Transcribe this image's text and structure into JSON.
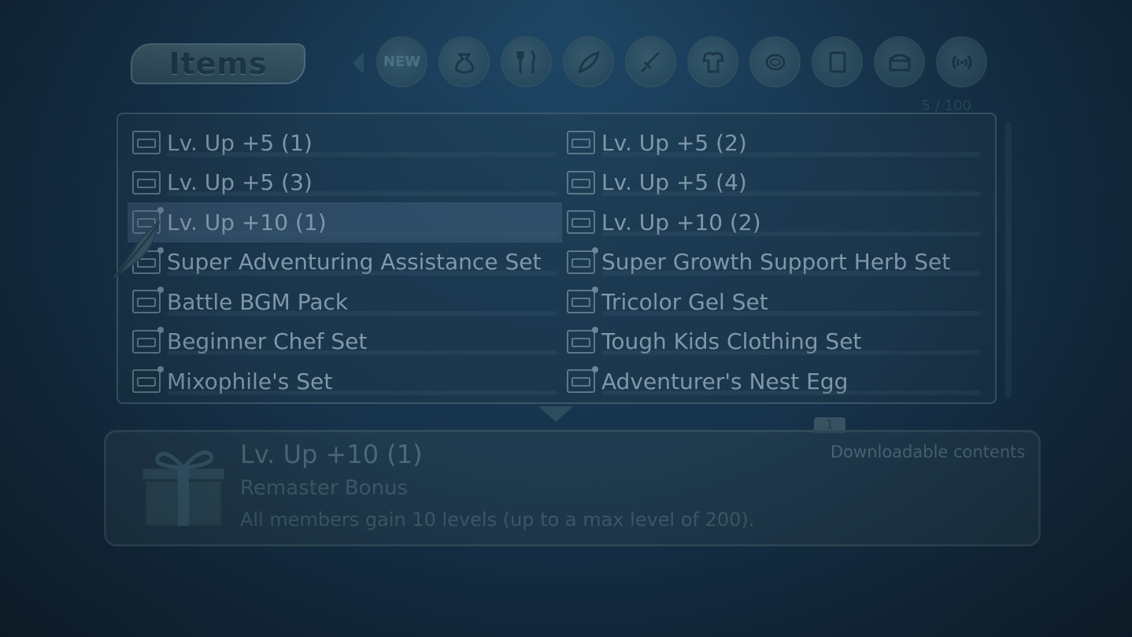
{
  "header": {
    "title": "Items",
    "count": "5 / 100",
    "tabs": [
      {
        "icon": "new-badge-icon",
        "label": "NEW"
      },
      {
        "icon": "pouch-icon"
      },
      {
        "icon": "fork-knife-icon"
      },
      {
        "icon": "leaf-icon"
      },
      {
        "icon": "sword-icon"
      },
      {
        "icon": "armor-icon"
      },
      {
        "icon": "ring-icon"
      },
      {
        "icon": "book-icon"
      },
      {
        "icon": "chest-icon"
      },
      {
        "icon": "wifi-icon"
      }
    ]
  },
  "list": {
    "items": [
      {
        "label": "Lv. Up +5 (1)",
        "selected": false,
        "dot": false
      },
      {
        "label": "Lv. Up +5 (2)",
        "selected": false,
        "dot": false
      },
      {
        "label": "Lv. Up +5 (3)",
        "selected": false,
        "dot": false
      },
      {
        "label": "Lv. Up +5 (4)",
        "selected": false,
        "dot": false
      },
      {
        "label": "Lv. Up +10 (1)",
        "selected": true,
        "dot": true
      },
      {
        "label": "Lv. Up +10 (2)",
        "selected": false,
        "dot": false
      },
      {
        "label": "Super Adventuring Assistance Set",
        "selected": false,
        "dot": true
      },
      {
        "label": "Super Growth Support Herb Set",
        "selected": false,
        "dot": true
      },
      {
        "label": "Battle BGM Pack",
        "selected": false,
        "dot": true
      },
      {
        "label": "Tricolor Gel Set",
        "selected": false,
        "dot": true
      },
      {
        "label": "Beginner Chef Set",
        "selected": false,
        "dot": true
      },
      {
        "label": "Tough Kids Clothing Set",
        "selected": false,
        "dot": true
      },
      {
        "label": "Mixophile's Set",
        "selected": false,
        "dot": true
      },
      {
        "label": "Adventurer's Nest Egg",
        "selected": false,
        "dot": true
      }
    ]
  },
  "detail": {
    "page": "1",
    "title": "Lv. Up +10 (1)",
    "subtitle": "Remaster Bonus",
    "description": "All members gain 10 levels (up to a max level of 200).",
    "category": "Downloadable contents",
    "icon": "gift-box-icon"
  },
  "colors": {
    "background": "#173650",
    "panel_border": "#3b5869",
    "text": "#7f97a8"
  }
}
